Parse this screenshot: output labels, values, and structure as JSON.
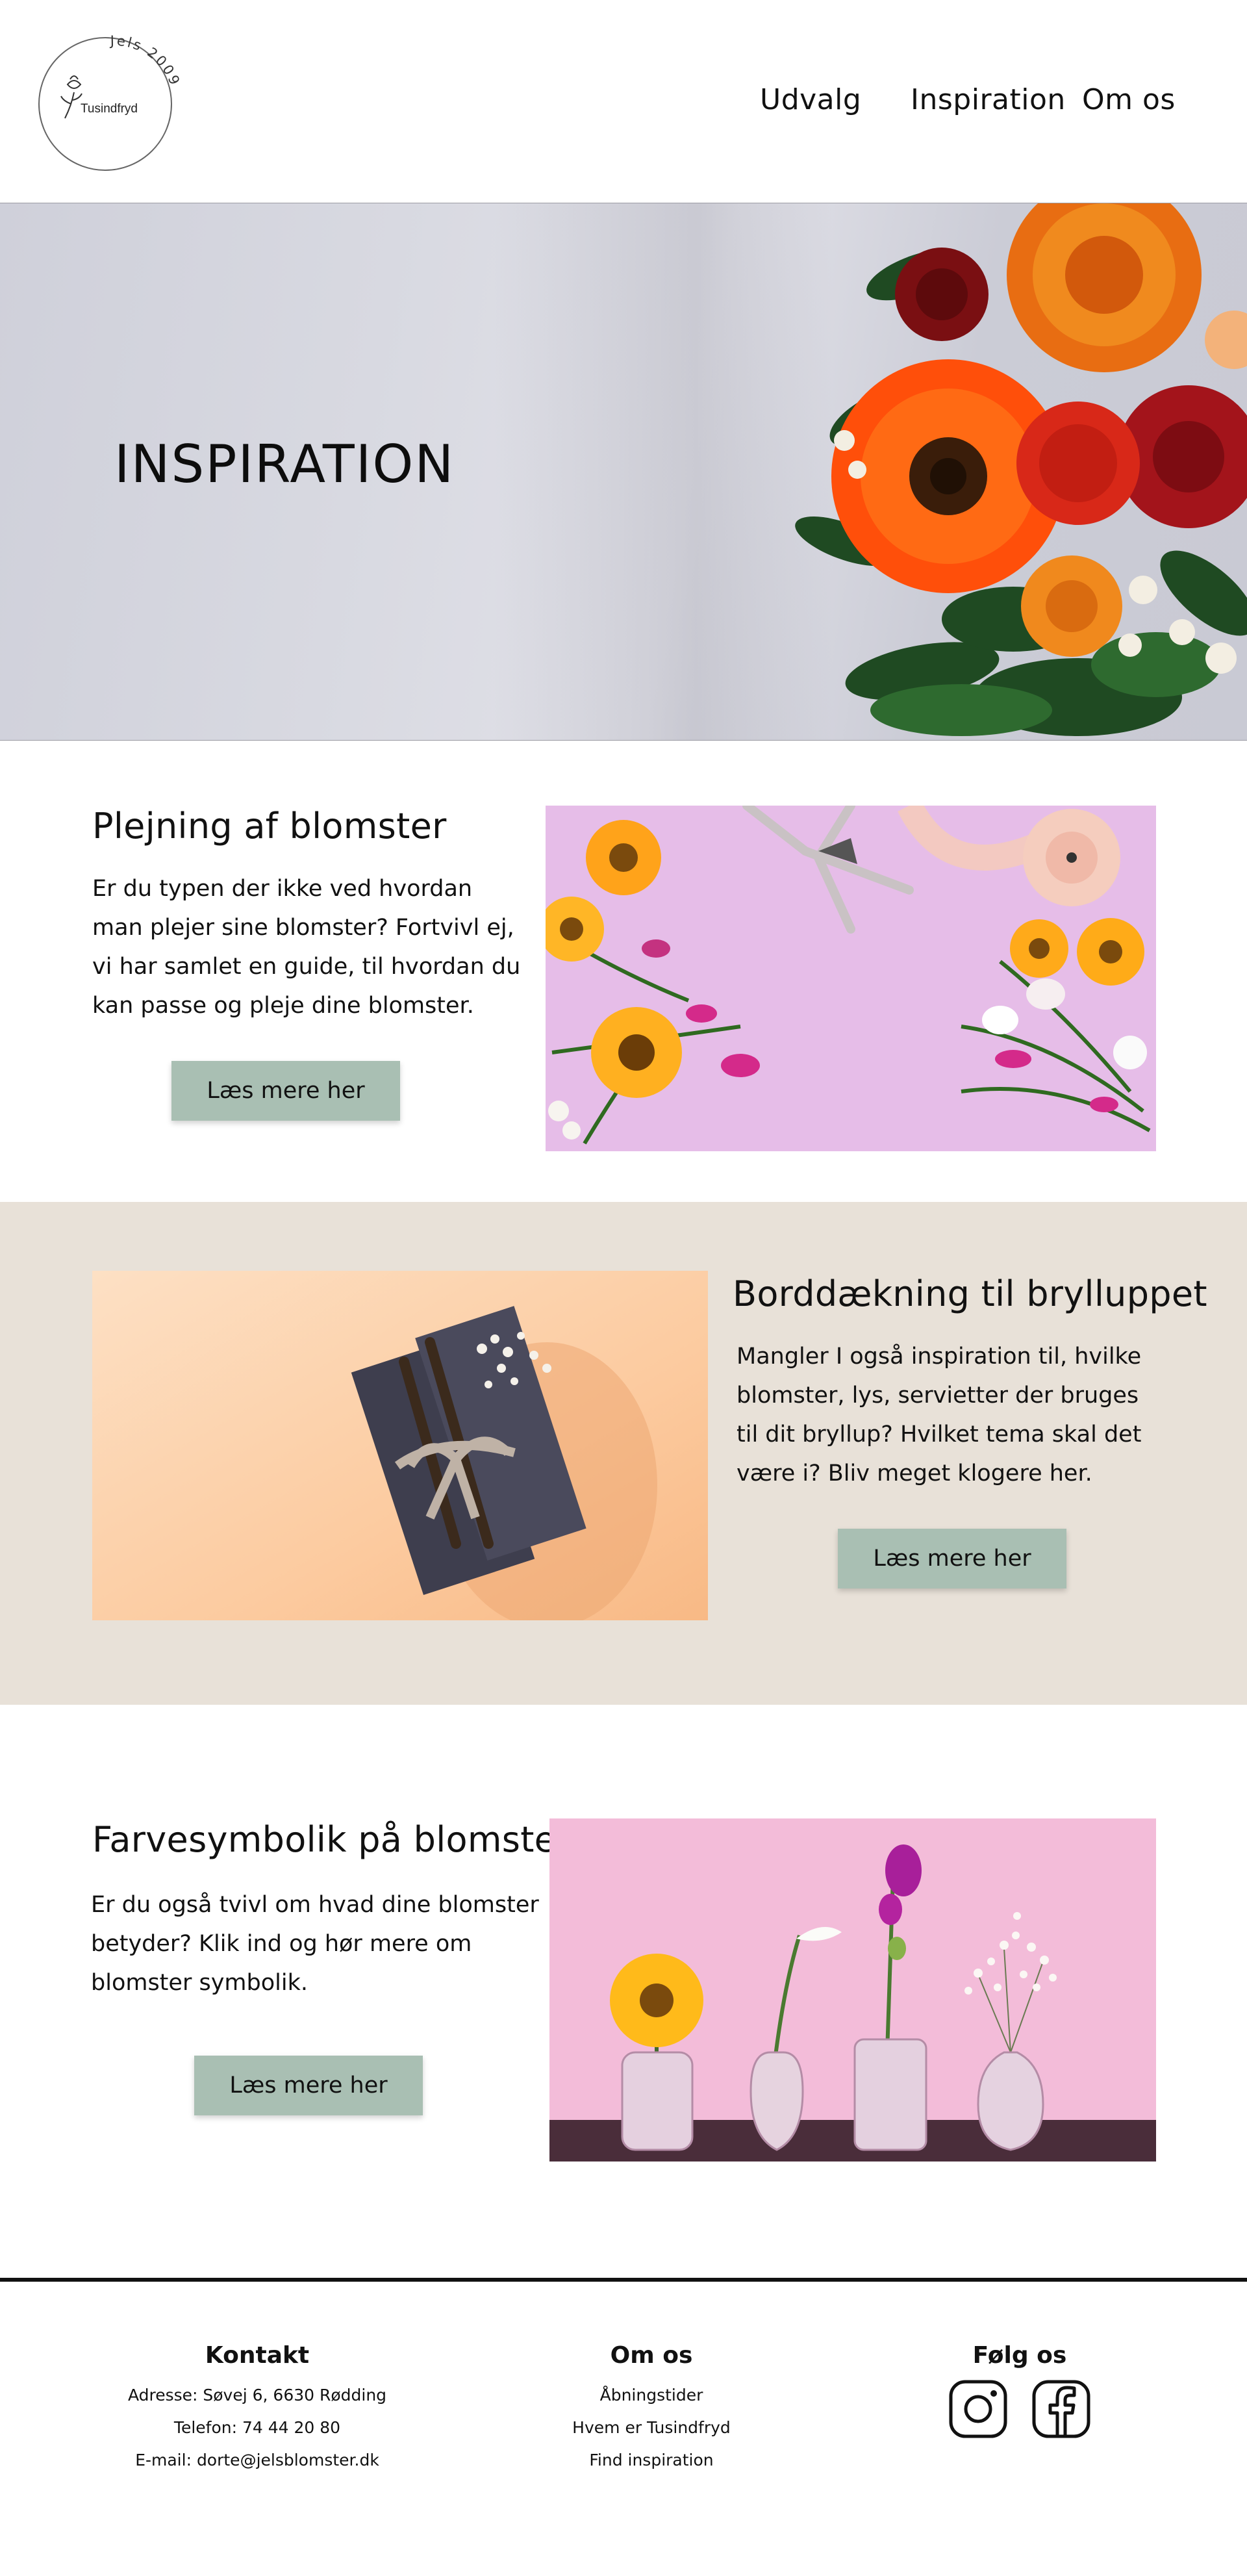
{
  "brand": {
    "name": "Tusindfryd",
    "arc_text": "Jels 2009"
  },
  "nav": {
    "items": [
      "Udvalg",
      "Inspiration",
      "Om os"
    ]
  },
  "hero": {
    "title": "INSPIRATION"
  },
  "sections": [
    {
      "title": "Plejning af blomster",
      "text": "Er du typen der ikke ved hvordan man plejer sine blomster? Fortvivl ej, vi har samlet en guide, til hvordan du kan passe og pleje dine blomster.",
      "button": "Læs mere her"
    },
    {
      "title": "Borddækning til brylluppet",
      "text": "Mangler I også inspiration til, hvilke blomster, lys, servietter der bruges til dit bryllup? Hvilket tema skal det være i? Bliv meget klogere her.",
      "button": "Læs mere her"
    },
    {
      "title": "Farvesymbolik på blomster",
      "text": "Er du også tvivl om hvad dine blomster betyder? Klik ind og hør mere om blomster symbolik.",
      "button": "Læs mere her"
    }
  ],
  "footer": {
    "contact": {
      "heading": "Kontakt",
      "lines": [
        "Adresse: Søvej 6, 6630 Rødding",
        "Telefon: 74 44 20 80",
        "E-mail: dorte@jelsblomster.dk"
      ]
    },
    "about": {
      "heading": "Om os",
      "links": [
        "Åbningstider",
        "Hvem er Tusindfryd",
        "Find inspiration"
      ]
    },
    "follow": {
      "heading": "Følg os",
      "icons": [
        "instagram-icon",
        "facebook-icon"
      ]
    }
  },
  "colors": {
    "button": "#a9bfb3",
    "band": "#e8e1d8",
    "text": "#111111"
  }
}
